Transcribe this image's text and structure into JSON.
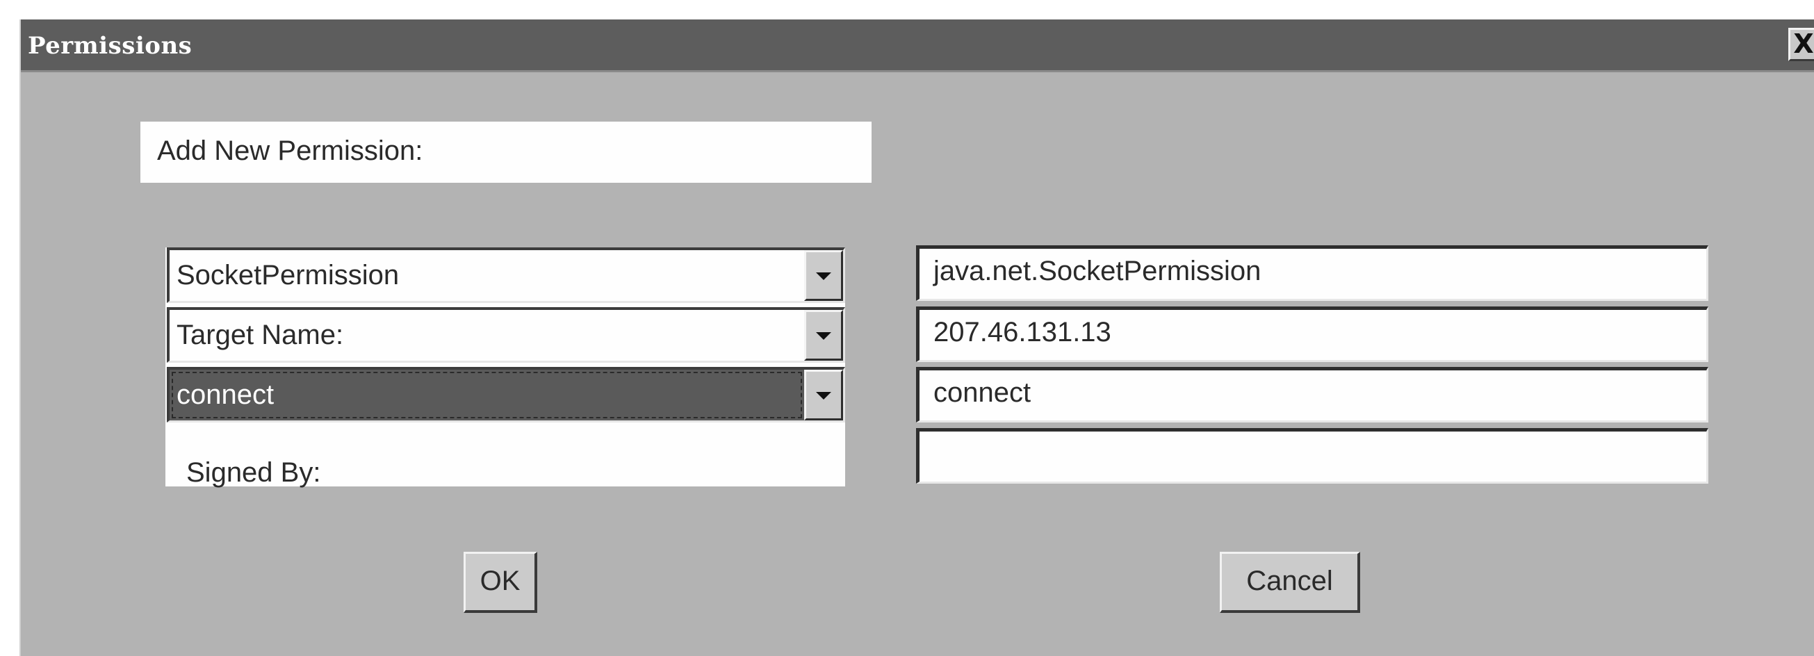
{
  "window": {
    "title": "Permissions",
    "close_label": "X"
  },
  "heading": "Add New Permission:",
  "left_column": {
    "permission_combo": "SocketPermission",
    "target_combo": "Target Name:",
    "actions_combo": "connect",
    "signed_by_label": "Signed By:"
  },
  "right_column": {
    "permission_class": "java.net.SocketPermission",
    "target_value": "207.46.131.13",
    "actions_value": "connect",
    "signed_by_value": ""
  },
  "buttons": {
    "ok": "OK",
    "cancel": "Cancel"
  },
  "colors": {
    "titlebar": "#5d5d5d",
    "dialog_background": "#b3b3b3",
    "field_background": "#fefefe",
    "selected_background": "#5a5a5a"
  },
  "icons": {
    "close": "close-icon",
    "dropdown": "chevron-down-icon"
  }
}
